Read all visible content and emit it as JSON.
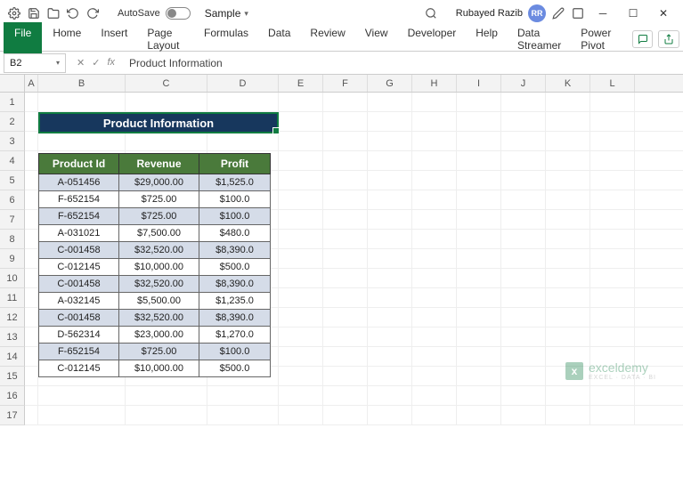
{
  "qat": {
    "autosave_label": "AutoSave",
    "doc_name": "Sample",
    "user_name": "Rubayed Razib",
    "user_initials": "RR"
  },
  "ribbon": {
    "tabs": [
      "File",
      "Home",
      "Insert",
      "Page Layout",
      "Formulas",
      "Data",
      "Review",
      "View",
      "Developer",
      "Help",
      "Data Streamer",
      "Power Pivot"
    ]
  },
  "formula_bar": {
    "cell_ref": "B2",
    "formula": "Product Information"
  },
  "columns": [
    "A",
    "B",
    "C",
    "D",
    "E",
    "F",
    "G",
    "H",
    "I",
    "J",
    "K",
    "L"
  ],
  "row_count": 17,
  "table": {
    "title": "Product Information",
    "headers": [
      "Product Id",
      "Revenue",
      "Profit"
    ],
    "rows": [
      {
        "id": "A-051456",
        "rev": "$29,000.00",
        "prof": "$1,525.0",
        "alt": true
      },
      {
        "id": "F-652154",
        "rev": "$725.00",
        "prof": "$100.0",
        "alt": false
      },
      {
        "id": "F-652154",
        "rev": "$725.00",
        "prof": "$100.0",
        "alt": true
      },
      {
        "id": "A-031021",
        "rev": "$7,500.00",
        "prof": "$480.0",
        "alt": false
      },
      {
        "id": "C-001458",
        "rev": "$32,520.00",
        "prof": "$8,390.0",
        "alt": true
      },
      {
        "id": "C-012145",
        "rev": "$10,000.00",
        "prof": "$500.0",
        "alt": false
      },
      {
        "id": "C-001458",
        "rev": "$32,520.00",
        "prof": "$8,390.0",
        "alt": true
      },
      {
        "id": "A-032145",
        "rev": "$5,500.00",
        "prof": "$1,235.0",
        "alt": false
      },
      {
        "id": "C-001458",
        "rev": "$32,520.00",
        "prof": "$8,390.0",
        "alt": true
      },
      {
        "id": "D-562314",
        "rev": "$23,000.00",
        "prof": "$1,270.0",
        "alt": false
      },
      {
        "id": "F-652154",
        "rev": "$725.00",
        "prof": "$100.0",
        "alt": true
      },
      {
        "id": "C-012145",
        "rev": "$10,000.00",
        "prof": "$500.0",
        "alt": false
      }
    ]
  },
  "watermark": {
    "main": "exceldemy",
    "sub": "EXCEL · DATA · BI"
  }
}
